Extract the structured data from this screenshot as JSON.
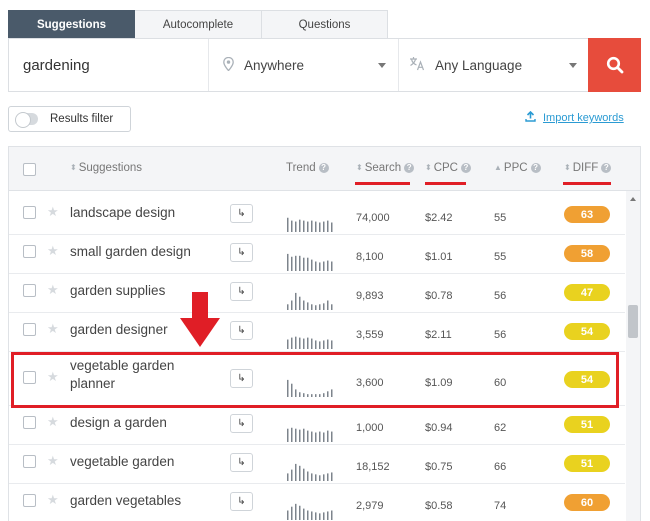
{
  "tabs": [
    {
      "label": "Suggestions",
      "active": true
    },
    {
      "label": "Autocomplete",
      "active": false
    },
    {
      "label": "Questions",
      "active": false
    }
  ],
  "search": {
    "keyword": "gardening",
    "location": "Anywhere",
    "language": "Any Language",
    "location_icon": "map-pin-icon",
    "language_icon": "translate-icon",
    "submit_icon": "search-icon"
  },
  "filter": {
    "label": "Results filter",
    "enabled": false
  },
  "import": {
    "label": "Import keywords",
    "icon": "upload-icon"
  },
  "table": {
    "headers": {
      "suggestions": "Suggestions",
      "trend": "Trend",
      "search": "Search",
      "cpc": "CPC",
      "ppc": "PPC",
      "diff": "DIFF"
    },
    "rows": [
      {
        "keyword": "landscape design",
        "search": "74,000",
        "cpc": "$2.42",
        "ppc": "55",
        "diff": "63",
        "diff_color": "#f0a033",
        "trend": [
          0.75,
          0.6,
          0.55,
          0.65,
          0.6,
          0.55,
          0.6,
          0.55,
          0.5,
          0.55,
          0.6,
          0.5
        ]
      },
      {
        "keyword": "small garden design",
        "search": "8,100",
        "cpc": "$1.01",
        "ppc": "55",
        "diff": "58",
        "diff_color": "#f0a033",
        "trend": [
          0.9,
          0.75,
          0.8,
          0.8,
          0.7,
          0.7,
          0.6,
          0.5,
          0.45,
          0.5,
          0.55,
          0.5
        ]
      },
      {
        "keyword": "garden supplies",
        "search": "9,893",
        "cpc": "$0.78",
        "ppc": "56",
        "diff": "47",
        "diff_color": "#e9d21f",
        "trend": [
          0.3,
          0.5,
          0.9,
          0.7,
          0.5,
          0.4,
          0.3,
          0.25,
          0.3,
          0.35,
          0.5,
          0.3
        ]
      },
      {
        "keyword": "garden designer",
        "search": "3,559",
        "cpc": "$2.11",
        "ppc": "56",
        "diff": "54",
        "diff_color": "#e9d21f",
        "trend": [
          0.5,
          0.6,
          0.65,
          0.6,
          0.55,
          0.6,
          0.55,
          0.45,
          0.4,
          0.45,
          0.5,
          0.45
        ]
      },
      {
        "keyword": "vegetable garden planner",
        "search": "3,600",
        "cpc": "$1.09",
        "ppc": "60",
        "diff": "54",
        "diff_color": "#e9d21f",
        "trend": [
          0.9,
          0.7,
          0.4,
          0.25,
          0.2,
          0.15,
          0.15,
          0.15,
          0.15,
          0.2,
          0.3,
          0.4
        ]
      },
      {
        "keyword": "design a garden",
        "search": "1,000",
        "cpc": "$0.94",
        "ppc": "62",
        "diff": "51",
        "diff_color": "#e9d21f",
        "trend": [
          0.7,
          0.75,
          0.7,
          0.65,
          0.7,
          0.6,
          0.55,
          0.5,
          0.55,
          0.5,
          0.6,
          0.55
        ]
      },
      {
        "keyword": "vegetable garden",
        "search": "18,152",
        "cpc": "$0.75",
        "ppc": "66",
        "diff": "51",
        "diff_color": "#e9d21f",
        "trend": [
          0.4,
          0.6,
          0.9,
          0.8,
          0.65,
          0.5,
          0.4,
          0.35,
          0.3,
          0.35,
          0.4,
          0.45
        ]
      },
      {
        "keyword": "garden vegetables",
        "search": "2,979",
        "cpc": "$0.58",
        "ppc": "74",
        "diff": "60",
        "diff_color": "#f0a033",
        "trend": [
          0.5,
          0.7,
          0.85,
          0.75,
          0.6,
          0.5,
          0.45,
          0.4,
          0.35,
          0.4,
          0.45,
          0.5
        ]
      }
    ]
  },
  "colors": {
    "accent_red": "#e74c3c",
    "annotation_red": "#e01e26",
    "tab_active": "#4a5a6a",
    "link": "#2b9bd3"
  }
}
